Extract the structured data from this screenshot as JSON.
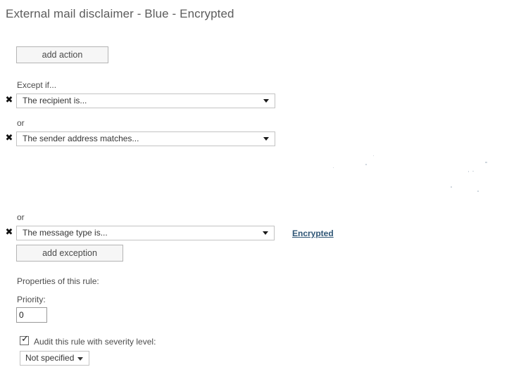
{
  "page": {
    "title": "External mail disclaimer - Blue - Encrypted"
  },
  "actions": {
    "add_action_label": "add action"
  },
  "exceptions": {
    "section_label": "Except if...",
    "or_label_1": "or",
    "or_label_2": "or",
    "add_exception_label": "add exception",
    "delete_icon": "close-x",
    "dropdown_arrow_icon": "chevron-down",
    "rows": [
      {
        "condition": "The recipient is...",
        "value": ""
      },
      {
        "condition": "The sender address matches...",
        "value": ""
      },
      {
        "condition": "The message type is...",
        "value": "Encrypted"
      }
    ]
  },
  "properties": {
    "section_label": "Properties of this rule:",
    "priority_label": "Priority:",
    "priority_value": "0",
    "audit_label": "Audit this rule with severity level:",
    "audit_checked_icon": "check-mark",
    "severity_value": "Not specified"
  },
  "colors": {
    "link": "#2f5676",
    "title_text": "#5c5c5c",
    "label_text": "#4c4c4c",
    "button_face": "#f6f6f6",
    "border": "#c3c3c3"
  }
}
